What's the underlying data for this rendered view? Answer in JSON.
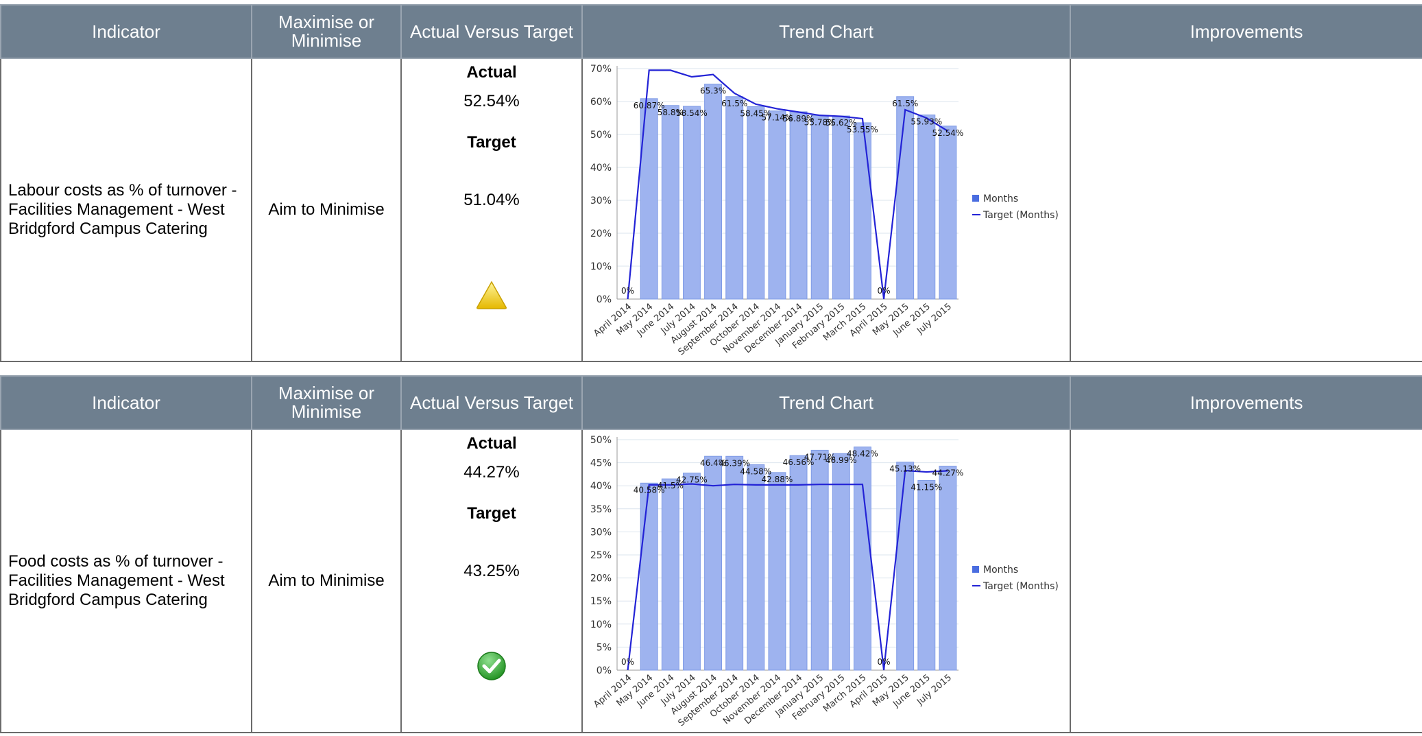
{
  "columns": {
    "indicator": "Indicator",
    "direction": "Maximise or Minimise",
    "avt": "Actual Versus Target",
    "trend": "Trend Chart",
    "improvements": "Improvements"
  },
  "rows": [
    {
      "indicator": "Labour costs as % of turnover - Facilities Management - West Bridgford Campus Catering",
      "direction": "Aim to Minimise",
      "actual_label": "Actual",
      "actual_value": "52.54%",
      "target_label": "Target",
      "target_value": "51.04%",
      "status_icon": "warning-triangle-icon",
      "improvements": ""
    },
    {
      "indicator": "Food costs as % of turnover - Facilities Management - West Bridgford Campus Catering",
      "direction": "Aim to Minimise",
      "actual_label": "Actual",
      "actual_value": "44.27%",
      "target_label": "Target",
      "target_value": "43.25%",
      "status_icon": "green-check-icon",
      "improvements": ""
    }
  ],
  "colors": {
    "header_bg": "#6e7f8f",
    "bar_fill": "#9eb3ef",
    "bar_stroke": "#7f9be6",
    "target_line": "#2323d6",
    "warning": "#f2d21b",
    "ok": "#2ea82e"
  },
  "chart_data": [
    {
      "type": "bar",
      "categories": [
        "April 2014",
        "May 2014",
        "June 2014",
        "July 2014",
        "August 2014",
        "September 2014",
        "October 2014",
        "November 2014",
        "December 2014",
        "January 2015",
        "February 2015",
        "March 2015",
        "April 2015",
        "May 2015",
        "June 2015",
        "July 2015"
      ],
      "series": [
        {
          "name": "Months",
          "values": [
            0,
            60.87,
            58.8,
            58.54,
            65.3,
            61.5,
            58.45,
            57.14,
            56.89,
            55.78,
            55.62,
            53.55,
            0,
            61.5,
            55.93,
            52.54
          ]
        },
        {
          "name": "Target (Months)",
          "kind": "line",
          "values": [
            0,
            69.5,
            69.5,
            67.5,
            68.2,
            62.5,
            59.2,
            57.8,
            56.8,
            55.8,
            55.5,
            54.8,
            0,
            57.5,
            55.0,
            51.04
          ]
        }
      ],
      "data_labels": [
        "0%",
        "60.87%",
        "58.8%",
        "58.54%",
        "65.3%",
        "61.5%",
        "58.45%",
        "57.14%",
        "56.89%",
        "55.78%",
        "55.62%",
        "53.55%",
        "0%",
        "61.5%",
        "55.93%",
        "52.54%"
      ],
      "yticks": [
        "0%",
        "10%",
        "20%",
        "30%",
        "40%",
        "50%",
        "60%",
        "70%"
      ],
      "ylim": [
        0,
        70
      ],
      "grid": true,
      "legend": "right"
    },
    {
      "type": "bar",
      "categories": [
        "April 2014",
        "May 2014",
        "June 2014",
        "July 2014",
        "August 2014",
        "September 2014",
        "October 2014",
        "November 2014",
        "December 2014",
        "January 2015",
        "February 2015",
        "March 2015",
        "April 2015",
        "May 2015",
        "June 2015",
        "July 2015"
      ],
      "series": [
        {
          "name": "Months",
          "values": [
            0,
            40.58,
            41.5,
            42.75,
            46.4,
            46.39,
            44.58,
            42.88,
            46.56,
            47.71,
            46.99,
            48.42,
            0,
            45.13,
            41.15,
            44.27
          ]
        },
        {
          "name": "Target (Months)",
          "kind": "line",
          "values": [
            0,
            40.2,
            40.2,
            40.4,
            40.0,
            40.3,
            40.2,
            40.2,
            40.2,
            40.3,
            40.3,
            40.3,
            0,
            43.3,
            43.0,
            43.25
          ]
        }
      ],
      "data_labels": [
        "0%",
        "40.58%",
        "41.5%",
        "42.75%",
        "46.4%",
        "46.39%",
        "44.58%",
        "42.88%",
        "46.56%",
        "47.71%",
        "46.99%",
        "48.42%",
        "0%",
        "45.13%",
        "41.15%",
        "44.27%"
      ],
      "yticks": [
        "0%",
        "5%",
        "10%",
        "15%",
        "20%",
        "25%",
        "30%",
        "35%",
        "40%",
        "45%",
        "50%"
      ],
      "ylim": [
        0,
        50
      ],
      "grid": true,
      "legend": "right"
    }
  ]
}
